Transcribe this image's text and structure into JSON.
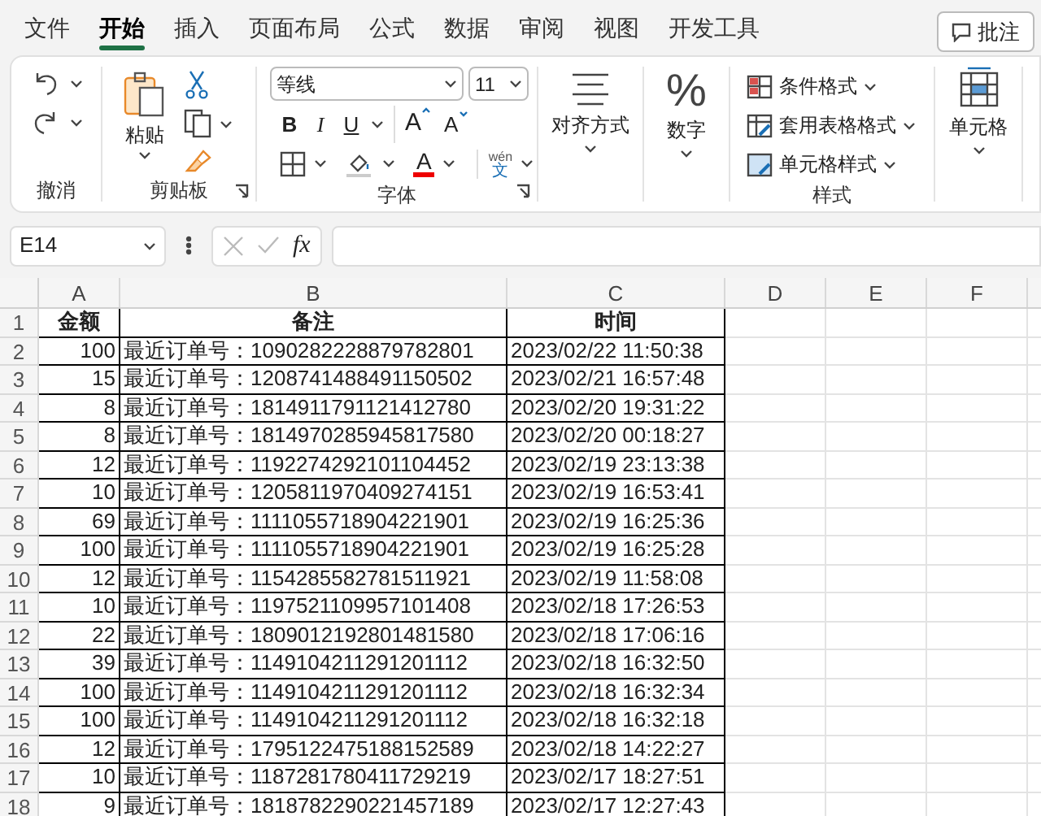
{
  "tabs": [
    {
      "label": "文件",
      "selected": false
    },
    {
      "label": "开始",
      "selected": true
    },
    {
      "label": "插入",
      "selected": false
    },
    {
      "label": "页面布局",
      "selected": false
    },
    {
      "label": "公式",
      "selected": false
    },
    {
      "label": "数据",
      "selected": false
    },
    {
      "label": "审阅",
      "selected": false
    },
    {
      "label": "视图",
      "selected": false
    },
    {
      "label": "开发工具",
      "selected": false
    }
  ],
  "comment_button": "批注",
  "ribbon": {
    "undo": {
      "label": "撤消"
    },
    "clipboard": {
      "label": "剪贴板",
      "paste": "粘贴"
    },
    "font": {
      "label": "字体",
      "font_name": "等线",
      "font_size": "11",
      "bold": "B",
      "italic": "I",
      "underline": "U",
      "grow": "A",
      "shrink": "A",
      "font_color": "A",
      "phonetic_pinyin": "wén",
      "phonetic_char": "文"
    },
    "alignment": {
      "label": "对齐方式"
    },
    "number": {
      "label": "数字",
      "glyph": "%"
    },
    "styles": {
      "label": "样式",
      "items": [
        "条件格式",
        "套用表格格式",
        "单元格样式"
      ]
    },
    "cells": {
      "label": "单元格"
    }
  },
  "formula_bar": {
    "name_box": "E14",
    "fx": "fx"
  },
  "sheet": {
    "columns": [
      "A",
      "B",
      "C",
      "D",
      "E",
      "F"
    ],
    "header": [
      "金额",
      "备注",
      "时间"
    ],
    "row_numbers": [
      "1",
      "2",
      "3",
      "4",
      "5",
      "6",
      "7",
      "8",
      "9",
      "10",
      "11",
      "12",
      "13",
      "14",
      "15",
      "16",
      "17",
      "18"
    ],
    "rows": [
      [
        "100",
        "最近订单号：1090282228879782801",
        "2023/02/22 11:50:38"
      ],
      [
        "15",
        "最近订单号：1208741488491150502",
        "2023/02/21 16:57:48"
      ],
      [
        "8",
        "最近订单号：1814911791121412780",
        "2023/02/20 19:31:22"
      ],
      [
        "8",
        "最近订单号：1814970285945817580",
        "2023/02/20 00:18:27"
      ],
      [
        "12",
        "最近订单号：1192274292101104452",
        "2023/02/19 23:13:38"
      ],
      [
        "10",
        "最近订单号：1205811970409274151",
        "2023/02/19 16:53:41"
      ],
      [
        "69",
        "最近订单号：1111055718904221901",
        "2023/02/19 16:25:36"
      ],
      [
        "100",
        "最近订单号：1111055718904221901",
        "2023/02/19 16:25:28"
      ],
      [
        "12",
        "最近订单号：1154285582781511921",
        "2023/02/19 11:58:08"
      ],
      [
        "10",
        "最近订单号：1197521109957101408",
        "2023/02/18 17:26:53"
      ],
      [
        "22",
        "最近订单号：1809012192801481580",
        "2023/02/18 17:06:16"
      ],
      [
        "39",
        "最近订单号：1149104211291201112",
        "2023/02/18 16:32:50"
      ],
      [
        "100",
        "最近订单号：1149104211291201112",
        "2023/02/18 16:32:34"
      ],
      [
        "100",
        "最近订单号：1149104211291201112",
        "2023/02/18 16:32:18"
      ],
      [
        "12",
        "最近订单号：1795122475188152589",
        "2023/02/18 14:22:27"
      ],
      [
        "10",
        "最近订单号：1187281780411729219",
        "2023/02/17 18:27:51"
      ],
      [
        "9",
        "最近订单号：1818782290221457189",
        "2023/02/17 12:27:43"
      ]
    ]
  }
}
